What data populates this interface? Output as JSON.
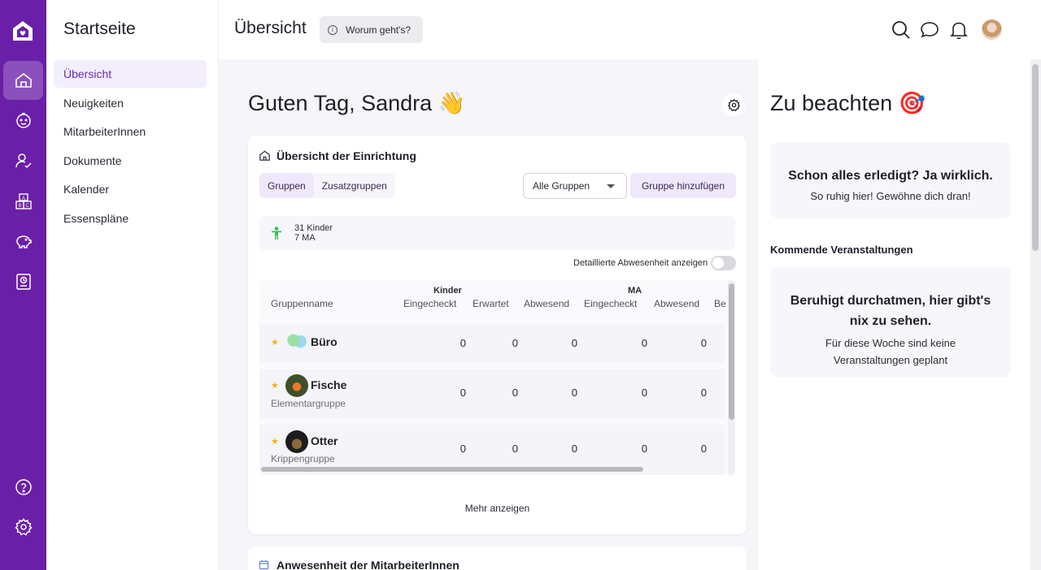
{
  "subnav": {
    "title": "Startseite",
    "items": [
      "Übersicht",
      "Neuigkeiten",
      "MitarbeiterInnen",
      "Dokumente",
      "Kalender",
      "Essenspläne"
    ]
  },
  "topbar": {
    "title": "Übersicht",
    "about_label": "Worum geht's?"
  },
  "main": {
    "greeting": "Guten Tag, Sandra 👋",
    "overview_card": {
      "title": "Übersicht der Einrichtung",
      "tabs": [
        "Gruppen",
        "Zusatzgruppen"
      ],
      "filter_value": "Alle Gruppen",
      "add_group_label": "Gruppe hinzufügen",
      "stats": {
        "children": "31 Kinder",
        "staff": "7 MA"
      },
      "toggle_label": "Detaillierte Abwesenheit anzeigen",
      "table": {
        "group_headers": {
          "children": "Kinder",
          "staff": "MA"
        },
        "columns": [
          "Gruppenname",
          "Eingecheckt",
          "Erwartet",
          "Abwesend",
          "Eingecheckt",
          "Abwesend",
          "Be"
        ],
        "rows": [
          {
            "name": "Büro",
            "subtitle": "",
            "values": [
              "0",
              "0",
              "0",
              "0",
              "0"
            ]
          },
          {
            "name": "Fische",
            "subtitle": "Elementargruppe",
            "values": [
              "0",
              "0",
              "0",
              "0",
              "0"
            ]
          },
          {
            "name": "Otter",
            "subtitle": "Krippengruppe",
            "values": [
              "0",
              "0",
              "0",
              "0",
              "0"
            ]
          }
        ]
      },
      "more_label": "Mehr anzeigen"
    },
    "attendance_card": {
      "title": "Anwesenheit der MitarbeiterInnen"
    }
  },
  "right": {
    "title": "Zu beachten 🎯",
    "todo_card": {
      "headline": "Schon alles erledigt? Ja wirklich.",
      "sub": "So ruhig hier! Gewöhne dich dran!"
    },
    "upcoming_label": "Kommende Veranstaltungen",
    "events_card": {
      "headline_1": "Beruhigt durchatmen, hier gibt's",
      "headline_2": "nix zu sehen.",
      "sub_1": "Für diese Woche sind keine",
      "sub_2": "Veranstaltungen geplant"
    }
  },
  "colors": {
    "accent": "#6a1fa8",
    "accent_light": "#efe7fa",
    "background": "#f6f5fa"
  },
  "icons": [
    "house-logo-icon",
    "home-icon",
    "child-face-icon",
    "person-check-icon",
    "abc-blocks-icon",
    "piggy-bank-icon",
    "clipboard-icon",
    "help-icon",
    "settings-icon",
    "search-icon",
    "chat-icon",
    "bell-icon",
    "gear-icon",
    "calendar-icon",
    "star-icon",
    "person-icon"
  ]
}
